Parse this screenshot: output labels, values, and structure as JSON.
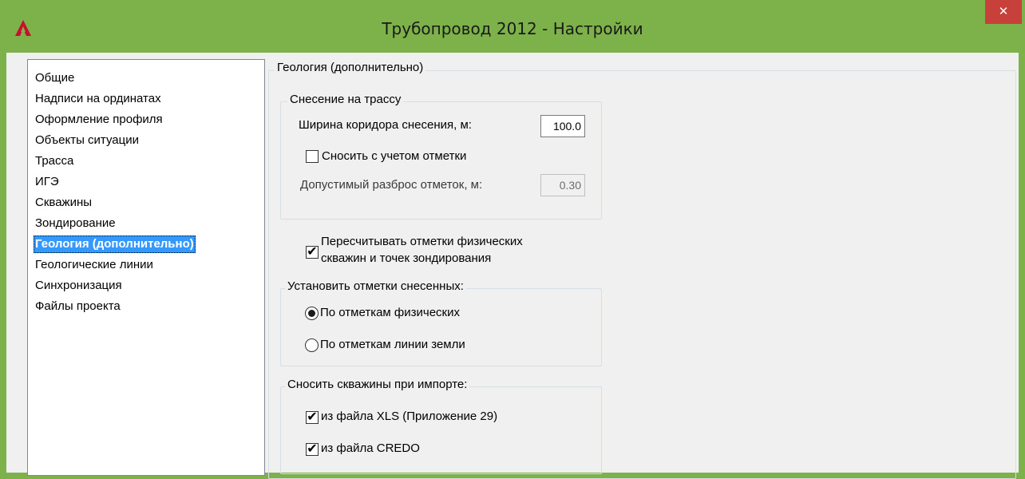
{
  "window": {
    "title": "Трубопровод 2012 - Настройки",
    "close_glyph": "✕",
    "app_icon": "autocad-a-icon",
    "accent_color": "#7db24a",
    "close_color": "#c7413a"
  },
  "sidebar": {
    "items": [
      {
        "label": "Общие"
      },
      {
        "label": "Надписи на ординатах"
      },
      {
        "label": "Оформление профиля"
      },
      {
        "label": "Объекты ситуации"
      },
      {
        "label": "Трасса"
      },
      {
        "label": "ИГЭ"
      },
      {
        "label": "Скважины"
      },
      {
        "label": "Зондирование"
      },
      {
        "label": "Геология (дополнительно)",
        "selected": true
      },
      {
        "label": "Геологические линии"
      },
      {
        "label": "Синхронизация"
      },
      {
        "label": "Файлы проекта"
      }
    ],
    "selected_color": "#3399ff"
  },
  "main": {
    "section_title": "Геология (дополнительно)",
    "projection": {
      "title": "Снесение на трассу",
      "corridor_label": "Ширина коридора снесения, м:",
      "corridor_value": "100.0",
      "snap_label": "Сносить с учетом отметки",
      "snap_checked": false,
      "spread_label": "Допустимый разброс отметок, м:",
      "spread_value": "0.30"
    },
    "recalc": {
      "line1": "Пересчитывать отметки физических",
      "line2": "скважин и точек зондирования",
      "checked": true,
      "check_glyph": "✔"
    },
    "set_elevations": {
      "title": "Установить отметки снесенных:",
      "option1": "По отметкам физических",
      "option2": "По отметкам линии земли",
      "selected": "option1"
    },
    "import": {
      "title": "Сносить скважины при импорте:",
      "xls_label": "из файла XLS (Приложение 29)",
      "xls_checked": true,
      "credo_label": "из файла CREDO",
      "credo_checked": true
    }
  }
}
